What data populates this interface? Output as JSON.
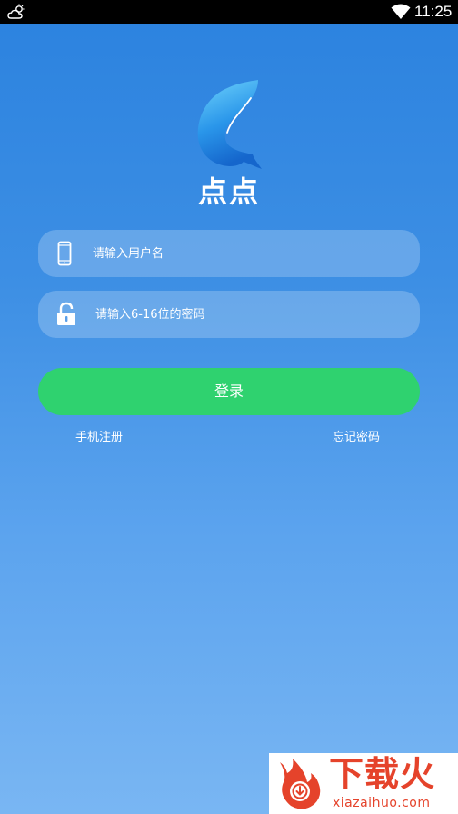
{
  "status_bar": {
    "time": "11:25",
    "weather_icon": "cloud-icon",
    "wifi_icon": "wifi-icon"
  },
  "app": {
    "logo_icon": "fish-logo-icon",
    "name": "点点"
  },
  "login_form": {
    "username_placeholder": "请输入用户名",
    "username_icon": "phone-icon",
    "password_placeholder": "请输入6-16位的密码",
    "password_icon": "lock-icon",
    "login_label": "登录"
  },
  "links": {
    "register": "手机注册",
    "forgot_password": "忘记密码"
  },
  "watermark": {
    "title": "下载火",
    "url": "xiazaihuo.com"
  },
  "colors": {
    "background_top": "#2b82df",
    "background_bottom": "#79b6f3",
    "login_button": "#2fd26f",
    "watermark_red": "#e5432b"
  }
}
